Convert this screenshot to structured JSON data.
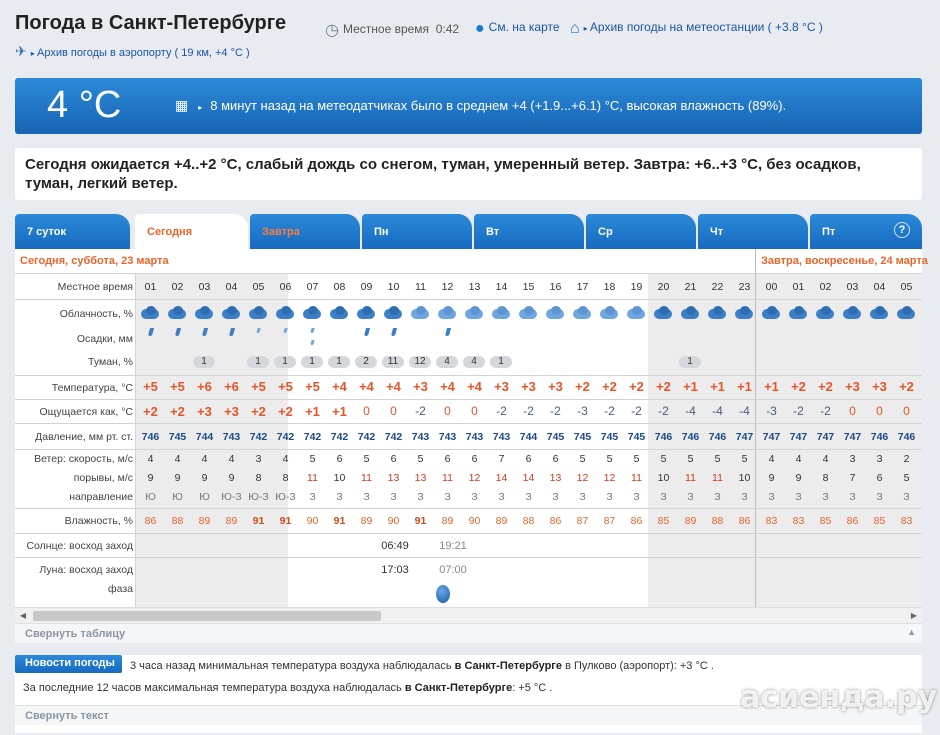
{
  "header": {
    "title": "Погода в Санкт-Петербурге",
    "local_time_label": "Местное время",
    "local_time": "0:42",
    "map_link": "См. на карте",
    "archive_station": "Архив погоды на метеостанции ( +3.8 °C )",
    "archive_airport": "Архив погоды в аэропорту ( 19 км, +4 °C )"
  },
  "now": {
    "temperature": "4 °C",
    "summary": "8 минут назад на метеодатчиках было в среднем +4 (+1.9...+6.1) °C, высокая влажность (89%)."
  },
  "forecast_text": "Сегодня ожидается +4..+2 °C, слабый дождь со снегом, туман, умеренный ветер. Завтра: +6..+3 °C, без осадков, туман, легкий ветер.",
  "tabs": [
    {
      "label": "7 суток"
    },
    {
      "label": "Сегодня"
    },
    {
      "label": "Завтра"
    },
    {
      "label": "Пн"
    },
    {
      "label": "Вт"
    },
    {
      "label": "Ср"
    },
    {
      "label": "Чт"
    },
    {
      "label": "Пт"
    }
  ],
  "help_icon": "?",
  "days": {
    "today": "Сегодня, суббота, 23 марта",
    "tomorrow": "Завтра, воскресенье, 24 марта"
  },
  "row_labels": {
    "time": "Местное время",
    "clouds": "Облачность, %",
    "precip": "Осадки, мм",
    "fog": "Туман, %",
    "temp": "Температура, °С",
    "feels": "Ощущается как, °С",
    "pressure": "Давление, мм рт. ст.",
    "wind_speed": "Ветер: скорость, м/с",
    "wind_gusts": "порывы, м/с",
    "wind_dir": "направление",
    "humidity": "Влажность, %",
    "sun": "Солнце: восход заход",
    "moon": "Луна: восход заход",
    "moon_phase": "фаза"
  },
  "hours": [
    "01",
    "02",
    "03",
    "04",
    "05",
    "06",
    "07",
    "08",
    "09",
    "10",
    "11",
    "12",
    "13",
    "14",
    "15",
    "16",
    "17",
    "18",
    "19",
    "20",
    "21",
    "22",
    "23",
    "00",
    "01",
    "02",
    "03",
    "04",
    "05"
  ],
  "fog": [
    "",
    "",
    "1",
    "",
    "1",
    "1",
    "1",
    "1",
    "2",
    "11",
    "12",
    "4",
    "4",
    "1",
    "",
    "",
    "",
    "",
    "",
    "",
    "1",
    "",
    "",
    "",
    "",
    "",
    "",
    "",
    ""
  ],
  "temp": [
    "+5",
    "+5",
    "+6",
    "+6",
    "+5",
    "+5",
    "+5",
    "+4",
    "+4",
    "+4",
    "+3",
    "+4",
    "+4",
    "+3",
    "+3",
    "+3",
    "+2",
    "+2",
    "+2",
    "+2",
    "+1",
    "+1",
    "+1",
    "+1",
    "+2",
    "+2",
    "+3",
    "+3",
    "+2"
  ],
  "feels": [
    "+2",
    "+2",
    "+3",
    "+3",
    "+2",
    "+2",
    "+1",
    "+1",
    "0",
    "0",
    "-2",
    "0",
    "0",
    "-2",
    "-2",
    "-2",
    "-3",
    "-2",
    "-2",
    "-2",
    "-4",
    "-4",
    "-4",
    "-3",
    "-2",
    "-2",
    "0",
    "0",
    "0"
  ],
  "pressure": [
    "746",
    "745",
    "744",
    "743",
    "742",
    "742",
    "742",
    "742",
    "742",
    "742",
    "743",
    "743",
    "743",
    "743",
    "744",
    "745",
    "745",
    "745",
    "745",
    "746",
    "746",
    "746",
    "747",
    "747",
    "747",
    "747",
    "747",
    "746",
    "746"
  ],
  "wind_speed": [
    "4",
    "4",
    "4",
    "4",
    "3",
    "4",
    "5",
    "6",
    "5",
    "6",
    "5",
    "6",
    "6",
    "7",
    "6",
    "6",
    "5",
    "5",
    "5",
    "5",
    "5",
    "5",
    "5",
    "4",
    "4",
    "4",
    "3",
    "3",
    "2"
  ],
  "wind_gusts": [
    "9",
    "9",
    "9",
    "9",
    "8",
    "8",
    "11",
    "10",
    "11",
    "13",
    "13",
    "11",
    "12",
    "14",
    "14",
    "13",
    "12",
    "12",
    "11",
    "10",
    "11",
    "11",
    "10",
    "9",
    "9",
    "8",
    "7",
    "6",
    "5"
  ],
  "wind_dir": [
    "Ю",
    "Ю",
    "Ю",
    "Ю-З",
    "Ю-З",
    "Ю-З",
    "З",
    "З",
    "З",
    "З",
    "З",
    "З",
    "З",
    "З",
    "З",
    "З",
    "З",
    "З",
    "З",
    "З",
    "З",
    "З",
    "З",
    "З",
    "З",
    "З",
    "З",
    "З",
    "З"
  ],
  "humidity": [
    "86",
    "88",
    "89",
    "89",
    "91",
    "91",
    "90",
    "91",
    "89",
    "90",
    "91",
    "89",
    "90",
    "89",
    "88",
    "86",
    "87",
    "87",
    "86",
    "85",
    "89",
    "88",
    "86",
    "83",
    "83",
    "85",
    "86",
    "85",
    "83"
  ],
  "sun": {
    "rise": "06:49",
    "set": "19:21"
  },
  "moon": {
    "rise": "17:03",
    "set": "07:00"
  },
  "collapse_table": "Свернуть таблицу",
  "news": {
    "tag": "Новости погоды",
    "line1_pre": "3 часа назад минимальная температура воздуха наблюдалась",
    "line1_city": "в Санкт-Петербурге",
    "line1_post": "в Пулково (аэропорт): +3 °C .",
    "line2_pre": "За последние 12 часов максимальная температура воздуха наблюдалась",
    "line2_city": "в Санкт-Петербурге",
    "line2_post": ": +5 °C .",
    "collapse": "Свернуть текст"
  },
  "watermark": "асиенда.ру"
}
